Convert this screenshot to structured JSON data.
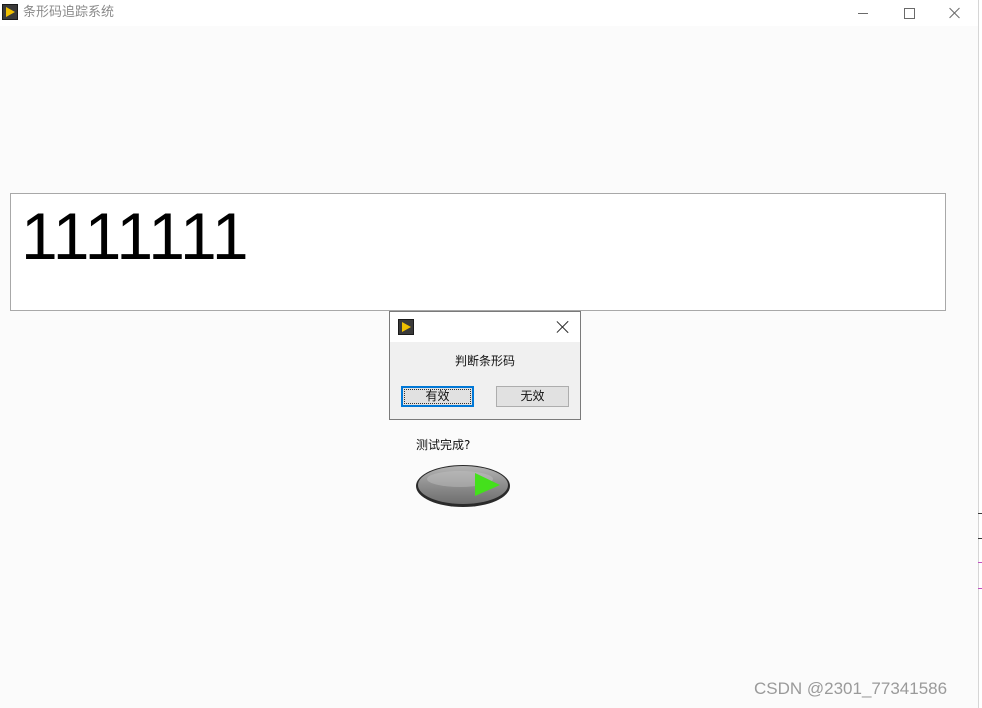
{
  "window": {
    "title": "条形码追踪系统",
    "icon": "labview-icon"
  },
  "barcode_display": {
    "value": "1111111"
  },
  "dialog": {
    "icon": "labview-icon",
    "message": "判断条形码",
    "buttons": {
      "valid_label": "有效",
      "invalid_label": "无效"
    }
  },
  "test_indicator": {
    "label": "测试完成?",
    "led_color": "#44e01c"
  },
  "watermark": {
    "text": "CSDN @2301_77341586"
  }
}
